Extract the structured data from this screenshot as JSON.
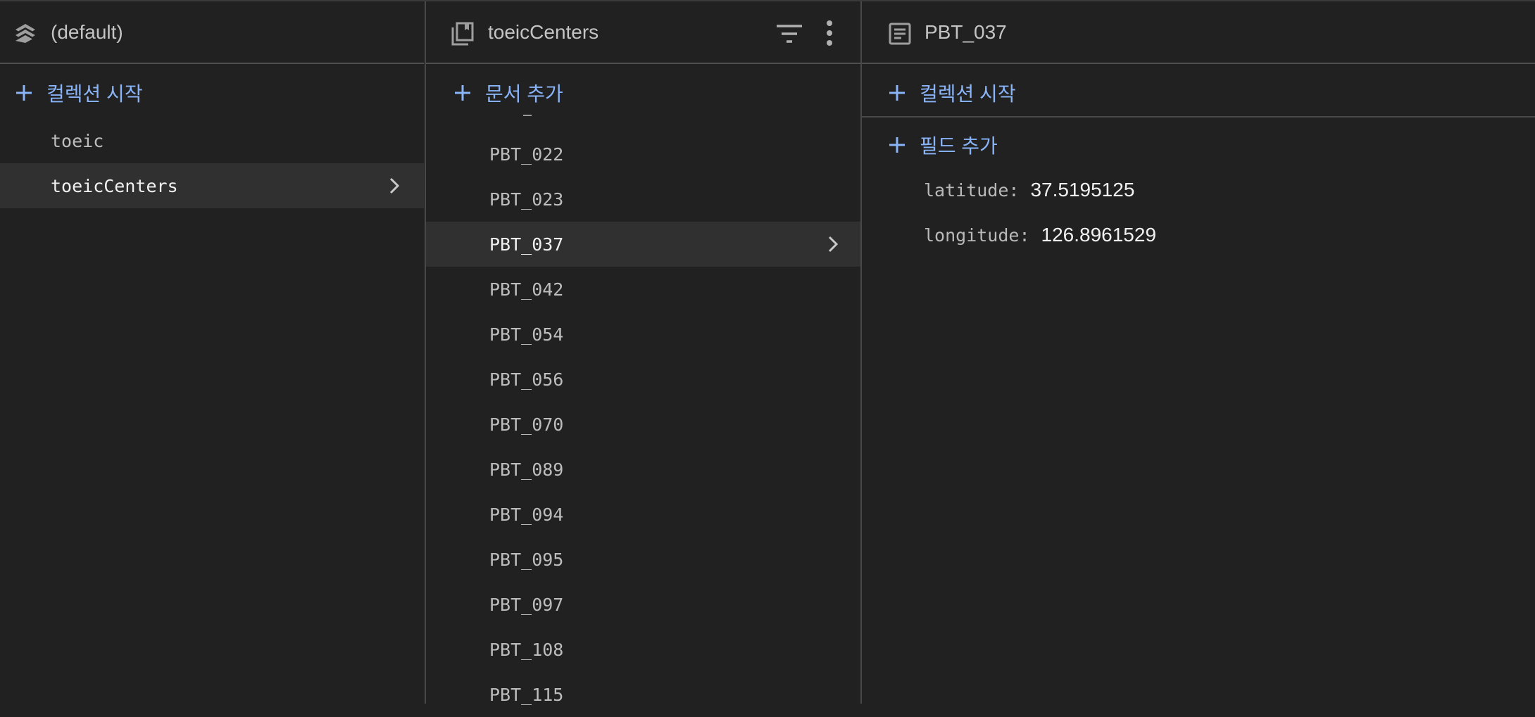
{
  "colors": {
    "accent": "#8ab4f8",
    "background": "#212121",
    "selected_row": "#303030"
  },
  "database_panel": {
    "title": "(default)",
    "icon": "firestore-stack-icon",
    "add_collection_label": "컬렉션 시작",
    "collections": [
      {
        "label": "toeic",
        "selected": false
      },
      {
        "label": "toeicCenters",
        "selected": true
      }
    ]
  },
  "collection_panel": {
    "title": "toeicCenters",
    "icon": "collection-icon",
    "add_document_label": "문서 추가",
    "documents": [
      {
        "label": "PBT_022",
        "selected": false
      },
      {
        "label": "PBT_023",
        "selected": false
      },
      {
        "label": "PBT_037",
        "selected": true
      },
      {
        "label": "PBT_042",
        "selected": false
      },
      {
        "label": "PBT_054",
        "selected": false
      },
      {
        "label": "PBT_056",
        "selected": false
      },
      {
        "label": "PBT_070",
        "selected": false
      },
      {
        "label": "PBT_089",
        "selected": false
      },
      {
        "label": "PBT_094",
        "selected": false
      },
      {
        "label": "PBT_095",
        "selected": false
      },
      {
        "label": "PBT_097",
        "selected": false
      },
      {
        "label": "PBT_108",
        "selected": false
      },
      {
        "label": "PBT_115",
        "selected": false
      }
    ]
  },
  "document_panel": {
    "title": "PBT_037",
    "icon": "document-icon",
    "add_collection_label": "컬렉션 시작",
    "add_field_label": "필드 추가",
    "fields": [
      {
        "key": "latitude:",
        "value": "37.5195125"
      },
      {
        "key": "longitude:",
        "value": "126.8961529"
      }
    ]
  }
}
